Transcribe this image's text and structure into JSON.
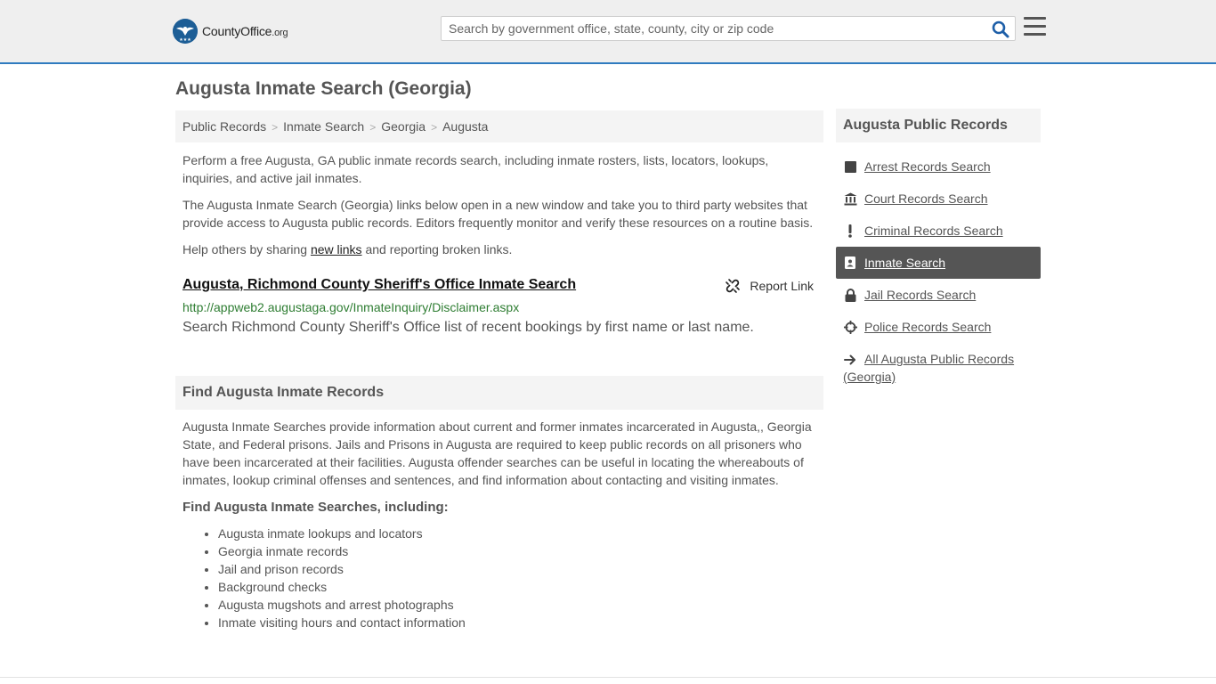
{
  "header": {
    "logo_text_main": "CountyOffice",
    "logo_text_suffix": ".org",
    "search_placeholder": "Search by government office, state, county, city or zip code"
  },
  "page": {
    "title": "Augusta Inmate Search (Georgia)"
  },
  "breadcrumb": [
    "Public Records",
    "Inmate Search",
    "Georgia",
    "Augusta"
  ],
  "intro": {
    "p1": "Perform a free Augusta, GA public inmate records search, including inmate rosters, lists, locators, lookups, inquiries, and active jail inmates.",
    "p2": "The Augusta Inmate Search (Georgia) links below open in a new window and take you to third party websites that provide access to Augusta public records. Editors frequently monitor and verify these resources on a routine basis.",
    "p3_before": "Help others by sharing ",
    "p3_link": "new links",
    "p3_after": " and reporting broken links."
  },
  "result": {
    "title": "Augusta, Richmond County Sheriff's Office Inmate Search",
    "report_label": "Report Link",
    "url": "http://appweb2.augustaga.gov/InmateInquiry/Disclaimer.aspx",
    "description": "Search Richmond County Sheriff's Office list of recent bookings by first name or last name."
  },
  "find_section": {
    "heading": "Find Augusta Inmate Records",
    "body": "Augusta Inmate Searches provide information about current and former inmates incarcerated in Augusta,, Georgia State, and Federal prisons. Jails and Prisons in Augusta are required to keep public records on all prisoners who have been incarcerated at their facilities. Augusta offender searches can be useful in locating the whereabouts of inmates, lookup criminal offenses and sentences, and find information about contacting and visiting inmates.",
    "subheading": "Find Augusta Inmate Searches, including:",
    "bullets": [
      "Augusta inmate lookups and locators",
      "Georgia inmate records",
      "Jail and prison records",
      "Background checks",
      "Augusta mugshots and arrest photographs",
      "Inmate visiting hours and contact information"
    ]
  },
  "sidebar": {
    "heading": "Augusta Public Records",
    "items": [
      {
        "label": "Arrest Records Search",
        "icon": "square-icon",
        "active": false
      },
      {
        "label": "Court Records Search",
        "icon": "courthouse-icon",
        "active": false
      },
      {
        "label": "Criminal Records Search",
        "icon": "exclamation-icon",
        "active": false
      },
      {
        "label": "Inmate Search",
        "icon": "id-badge-icon",
        "active": true
      },
      {
        "label": "Jail Records Search",
        "icon": "lock-icon",
        "active": false
      },
      {
        "label": "Police Records Search",
        "icon": "crosshair-icon",
        "active": false
      },
      {
        "label": "All Augusta Public Records (Georgia)",
        "icon": "arrow-right-icon",
        "active": false
      }
    ]
  },
  "colors": {
    "accent_blue": "#2f7bbf",
    "search_icon": "#1e5fa8",
    "url_green": "#2e7d32",
    "active_bg": "#555555"
  }
}
